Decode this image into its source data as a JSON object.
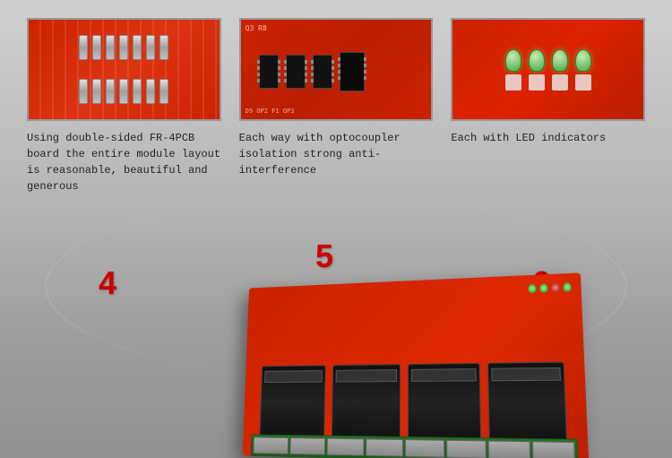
{
  "features": [
    {
      "id": "feature-4",
      "number": "4",
      "image_alt": "Double-sided FR-4 PCB board",
      "description": "Using double-sided FR-4PCB board the entire module layout is reasonable, beautiful and generous"
    },
    {
      "id": "feature-5",
      "number": "5",
      "image_alt": "Optocoupler isolation circuit board",
      "description": "Each way with optocoupler isolation strong anti-interference"
    },
    {
      "id": "feature-6",
      "number": "6",
      "image_alt": "LED indicators on PCB",
      "description": "Each with LED indicators"
    }
  ],
  "number_badges": {
    "badge_4": "4",
    "badge_5": "5",
    "badge_6": "6"
  }
}
